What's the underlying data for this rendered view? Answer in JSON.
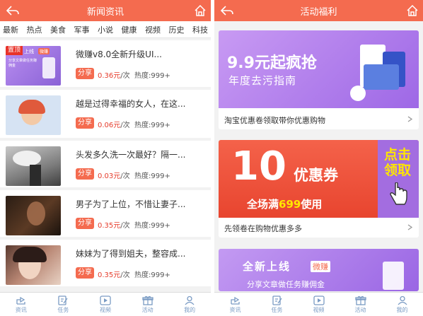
{
  "left": {
    "header": {
      "title": "新闻资讯"
    },
    "categories": [
      "最新",
      "热点",
      "美食",
      "军事",
      "小说",
      "健康",
      "视频",
      "历史",
      "科技"
    ],
    "news": [
      {
        "title": "微赚v8.0全新升级UI...",
        "share": "分享",
        "price": "0.36元",
        "unit": "/次",
        "heat": "热度:999+",
        "pin": "置顶",
        "thumb_text_1": "上线",
        "thumb_badge": "微赚",
        "thumb_text_2": "分享文章做任务赚佣金"
      },
      {
        "title": "越是过得幸福的女人，在这...",
        "share": "分享",
        "price": "0.06元",
        "unit": "/次",
        "heat": "热度:999+"
      },
      {
        "title": "头发多久洗一次最好？隔一...",
        "share": "分享",
        "price": "0.03元",
        "unit": "/次",
        "heat": "热度:999+"
      },
      {
        "title": "男子为了上位，不惜让妻子...",
        "share": "分享",
        "price": "0.35元",
        "unit": "/次",
        "heat": "热度:999+"
      },
      {
        "title": "妹妹为了得到姐夫，整容成...",
        "share": "分享",
        "price": "0.35元",
        "unit": "/次",
        "heat": "热度:999+"
      }
    ],
    "tabs": [
      "资讯",
      "任务",
      "视频",
      "活动",
      "我的"
    ]
  },
  "right": {
    "header": {
      "title": "活动福利"
    },
    "promos": [
      {
        "headline": "9.9元起疯抢",
        "subline": "年度去污指南",
        "caption": "淘宝优惠卷领取带你优惠购物"
      },
      {
        "bignum": "10",
        "coupon": "优惠券",
        "line_pre": "全场满",
        "line_num": "699",
        "line_post": "使用",
        "cta": "点击领取",
        "caption": "先领卷在购物优惠多多"
      },
      {
        "headline": "全新上线",
        "badge": "微赚",
        "subline": "分享文章做任务赚佣金"
      }
    ],
    "tabs": [
      "资讯",
      "任务",
      "视频",
      "活动",
      "我的"
    ]
  },
  "colors": {
    "primary": "#f46b4f",
    "price": "#e63b2a",
    "tab_icon": "#7a9bc4",
    "promo_purple": "#a36de0"
  }
}
